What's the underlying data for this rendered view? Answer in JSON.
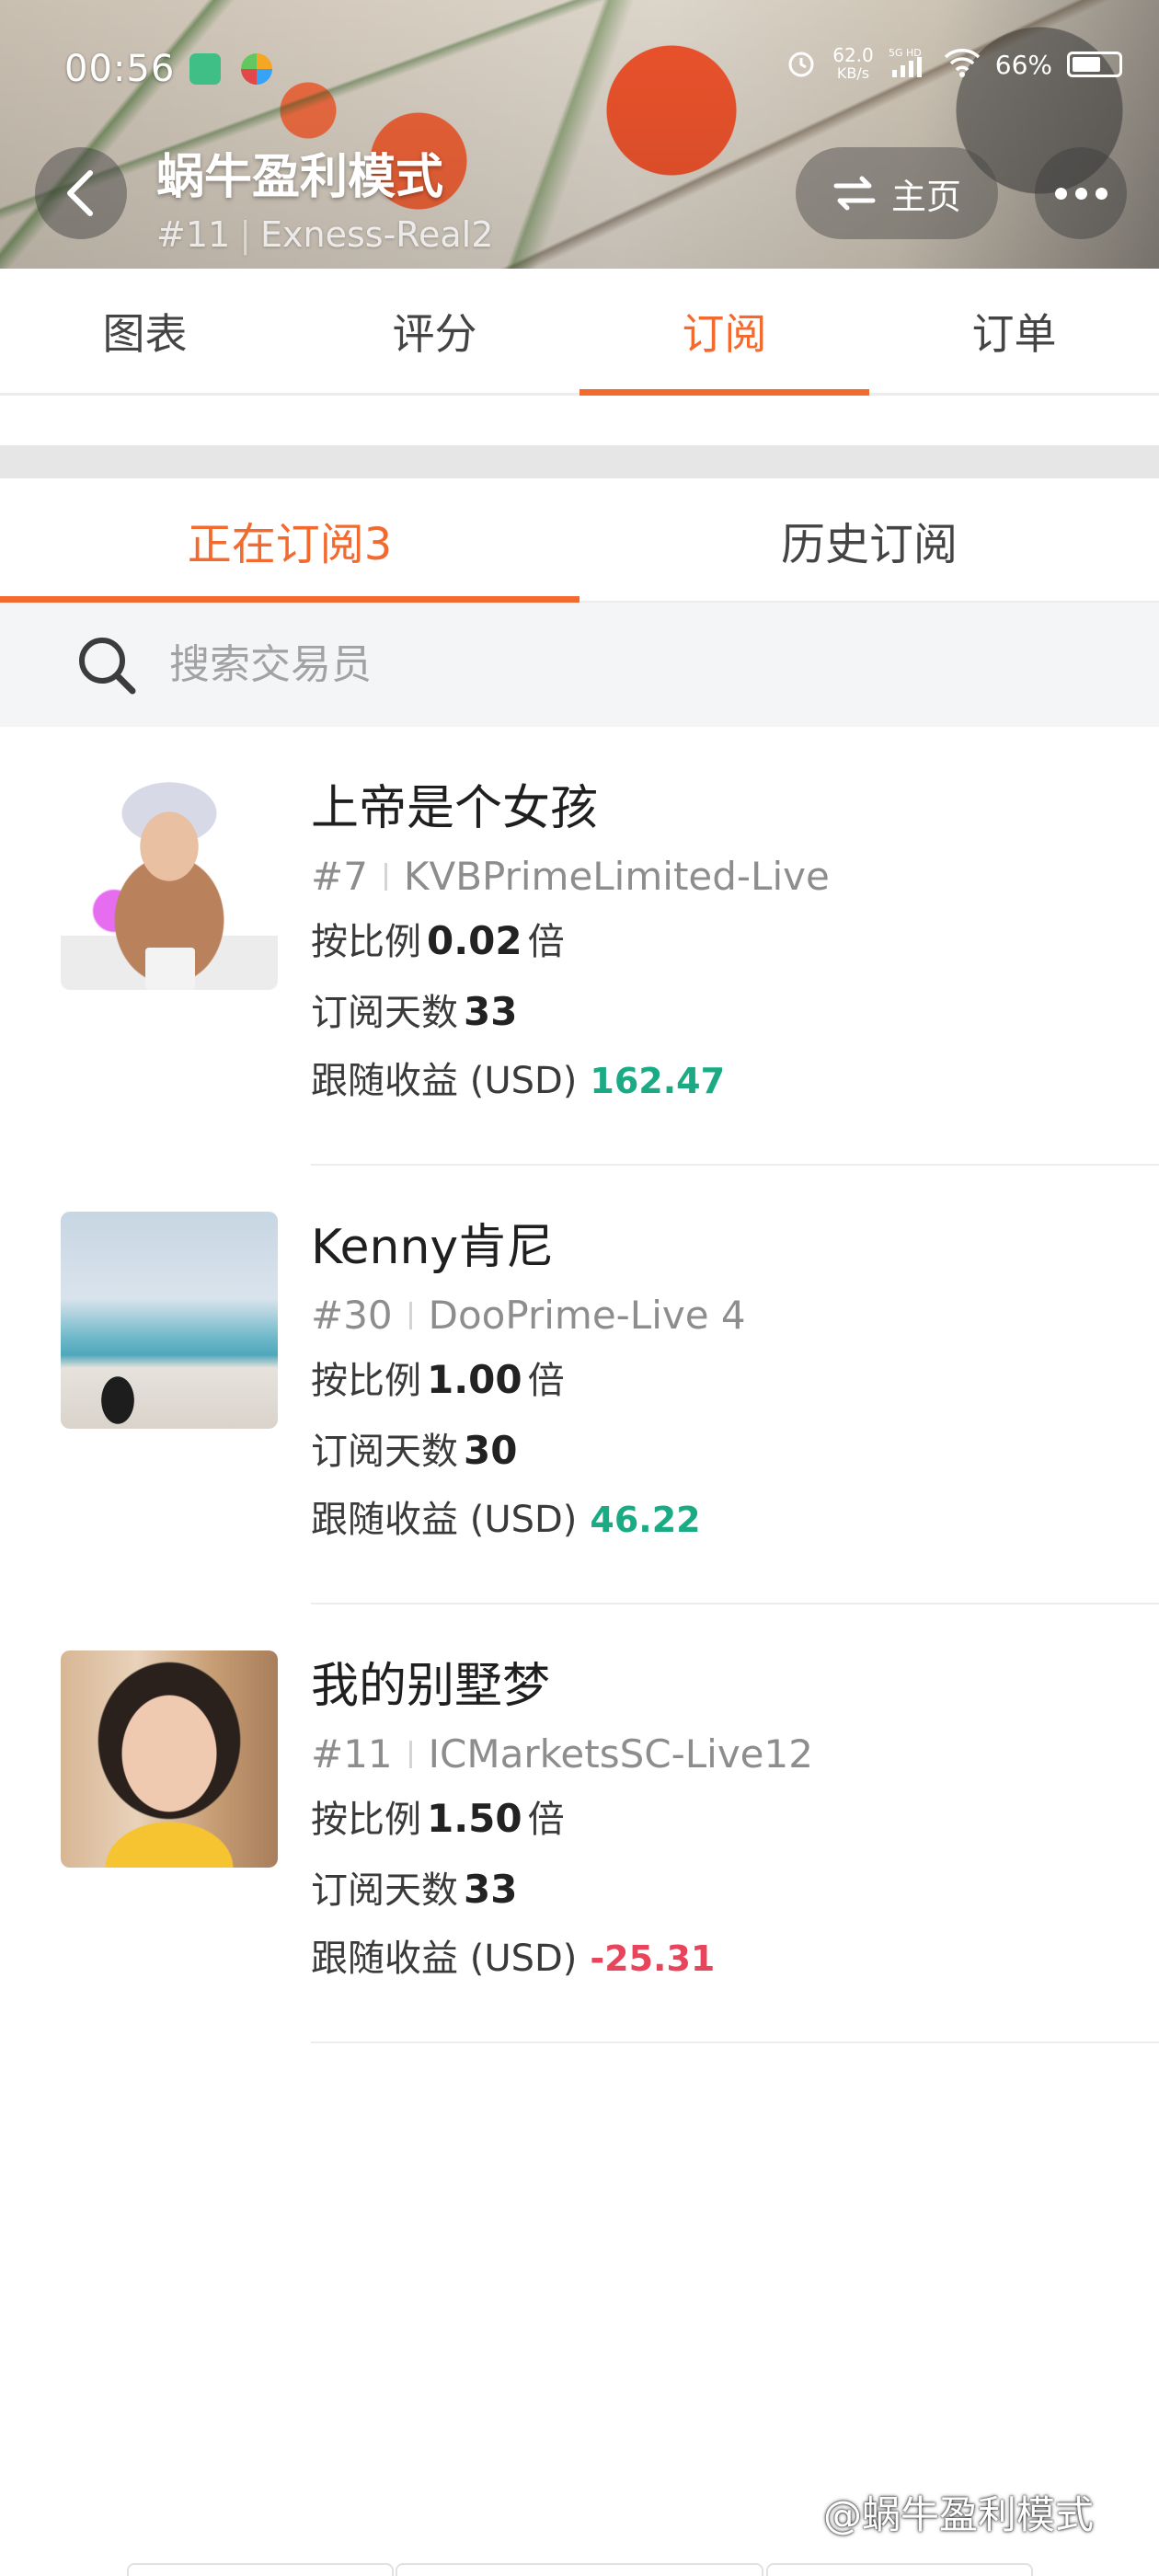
{
  "status_bar": {
    "time": "00:56",
    "net_speed": "62.0",
    "net_unit": "KB/s",
    "network": "5G HD",
    "battery": "66%"
  },
  "header": {
    "title": "蜗牛盈利模式",
    "rank": "#11",
    "account": "Exness-Real2",
    "home_label": "主页",
    "back_icon": "chevron-left-icon",
    "swap_icon": "swap-arrows-icon",
    "more_icon": "more-dots-icon"
  },
  "main_tabs": [
    {
      "label": "图表",
      "active": false
    },
    {
      "label": "评分",
      "active": false
    },
    {
      "label": "订阅",
      "active": true
    },
    {
      "label": "订单",
      "active": false
    }
  ],
  "sub_tabs": [
    {
      "label": "正在订阅3",
      "active": true
    },
    {
      "label": "历史订阅",
      "active": false
    }
  ],
  "search": {
    "placeholder": "搜索交易员"
  },
  "labels": {
    "ratio_prefix": "按比例",
    "ratio_suffix": "倍",
    "days_label": "订阅天数",
    "profit_label": "跟随收益 (USD)"
  },
  "subscriptions": [
    {
      "name": "上帝是个女孩",
      "rank": "#7",
      "broker": "KVBPrimeLimited-Live",
      "ratio": "0.02",
      "days": "33",
      "profit": "162.47",
      "profit_sign": "positive"
    },
    {
      "name": "Kenny肯尼",
      "rank": "#30",
      "broker": "DooPrime-Live 4",
      "ratio": "1.00",
      "days": "30",
      "profit": "46.22",
      "profit_sign": "positive"
    },
    {
      "name": "我的别墅梦",
      "rank": "#11",
      "broker": "ICMarketsSC-Live12",
      "ratio": "1.50",
      "days": "33",
      "profit": "-25.31",
      "profit_sign": "negative"
    }
  ],
  "watermark": "@蜗牛盈利模式",
  "colors": {
    "accent": "#f26a2e",
    "profit_positive": "#1aab84",
    "profit_negative": "#e8445b"
  }
}
